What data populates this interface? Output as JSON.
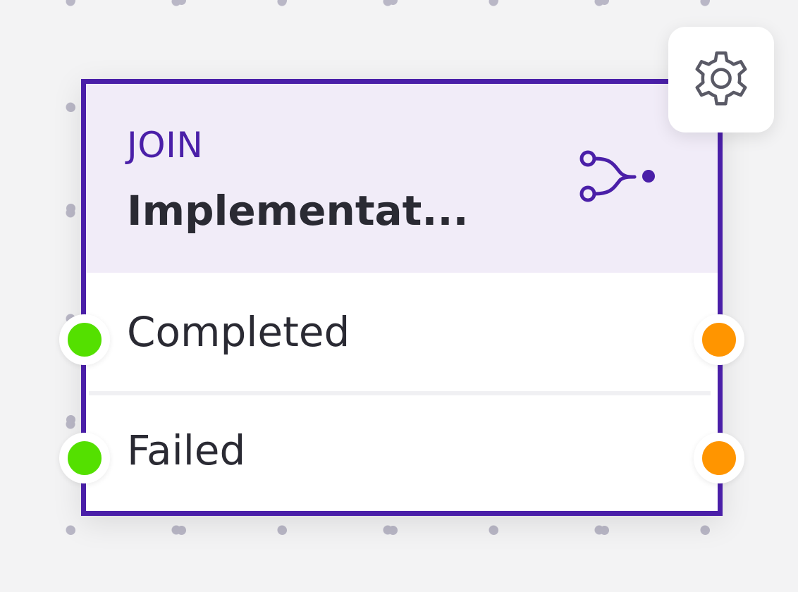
{
  "node": {
    "type_label": "JOIN",
    "title": "Implementat...",
    "icon": "join-icon",
    "accent_color": "#4a1fa8",
    "header_bg": "#f1ecf8",
    "settings_icon": "gear-icon",
    "outputs": [
      {
        "label": "Completed",
        "input_color": "#54e000",
        "output_color": "#ff9500"
      },
      {
        "label": "Failed",
        "input_color": "#54e000",
        "output_color": "#ff9500"
      }
    ]
  }
}
